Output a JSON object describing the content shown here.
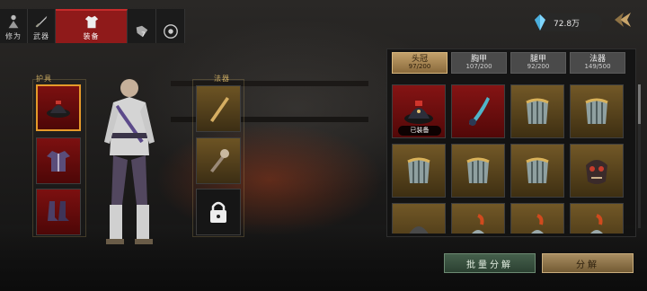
{
  "nav": {
    "tabs": [
      {
        "label": "修为",
        "icon": "cultivator-icon"
      },
      {
        "label": "武器",
        "icon": "sword-icon"
      },
      {
        "label": "装备",
        "icon": "robe-icon"
      },
      {
        "label": "",
        "icon": "accessory-icon"
      },
      {
        "label": "",
        "icon": "mandala-icon"
      }
    ],
    "active_index": 2
  },
  "currency": {
    "amount": "72.8万",
    "icon": "crystal-icon"
  },
  "left": {
    "armor_group_label": "护具",
    "artifact_group_label": "法器",
    "armor_slots": [
      "hat-icon",
      "robe-icon",
      "boots-icon"
    ],
    "artifact_slots": [
      "staff-icon",
      "club-icon",
      "lock-icon"
    ]
  },
  "tabs": [
    {
      "name": "头冠",
      "count": "97/200"
    },
    {
      "name": "胸甲",
      "count": "107/200"
    },
    {
      "name": "腿甲",
      "count": "92/200"
    },
    {
      "name": "法器",
      "count": "149/500"
    }
  ],
  "active_tab": 0,
  "grid": {
    "equipped_label": "已装备",
    "items": [
      {
        "icon": "crown-hat-icon",
        "quality": "red",
        "equipped": true
      },
      {
        "icon": "feather-hat-icon",
        "quality": "red",
        "equipped": false
      },
      {
        "icon": "leg-armor-icon",
        "quality": "gold",
        "equipped": false
      },
      {
        "icon": "leg-armor-icon",
        "quality": "gold",
        "equipped": false
      },
      {
        "icon": "leg-armor-icon",
        "quality": "gold",
        "equipped": false
      },
      {
        "icon": "leg-armor-icon",
        "quality": "gold",
        "equipped": false
      },
      {
        "icon": "leg-armor-icon",
        "quality": "gold",
        "equipped": false
      },
      {
        "icon": "demon-mask-icon",
        "quality": "gold",
        "equipped": false
      },
      {
        "icon": "helmet-icon",
        "quality": "gold",
        "equipped": false
      },
      {
        "icon": "plumed-helmet-icon",
        "quality": "gold",
        "equipped": false
      },
      {
        "icon": "plumed-helmet-icon",
        "quality": "gold",
        "equipped": false
      },
      {
        "icon": "plumed-helmet-icon",
        "quality": "gold",
        "equipped": false
      }
    ]
  },
  "buttons": {
    "bulk_decompose": "批量分解",
    "decompose": "分解"
  },
  "colors": {
    "accent_red": "#8f1a1a",
    "gold_tab": "#c2a06a",
    "selected_border": "#e59a2a"
  }
}
